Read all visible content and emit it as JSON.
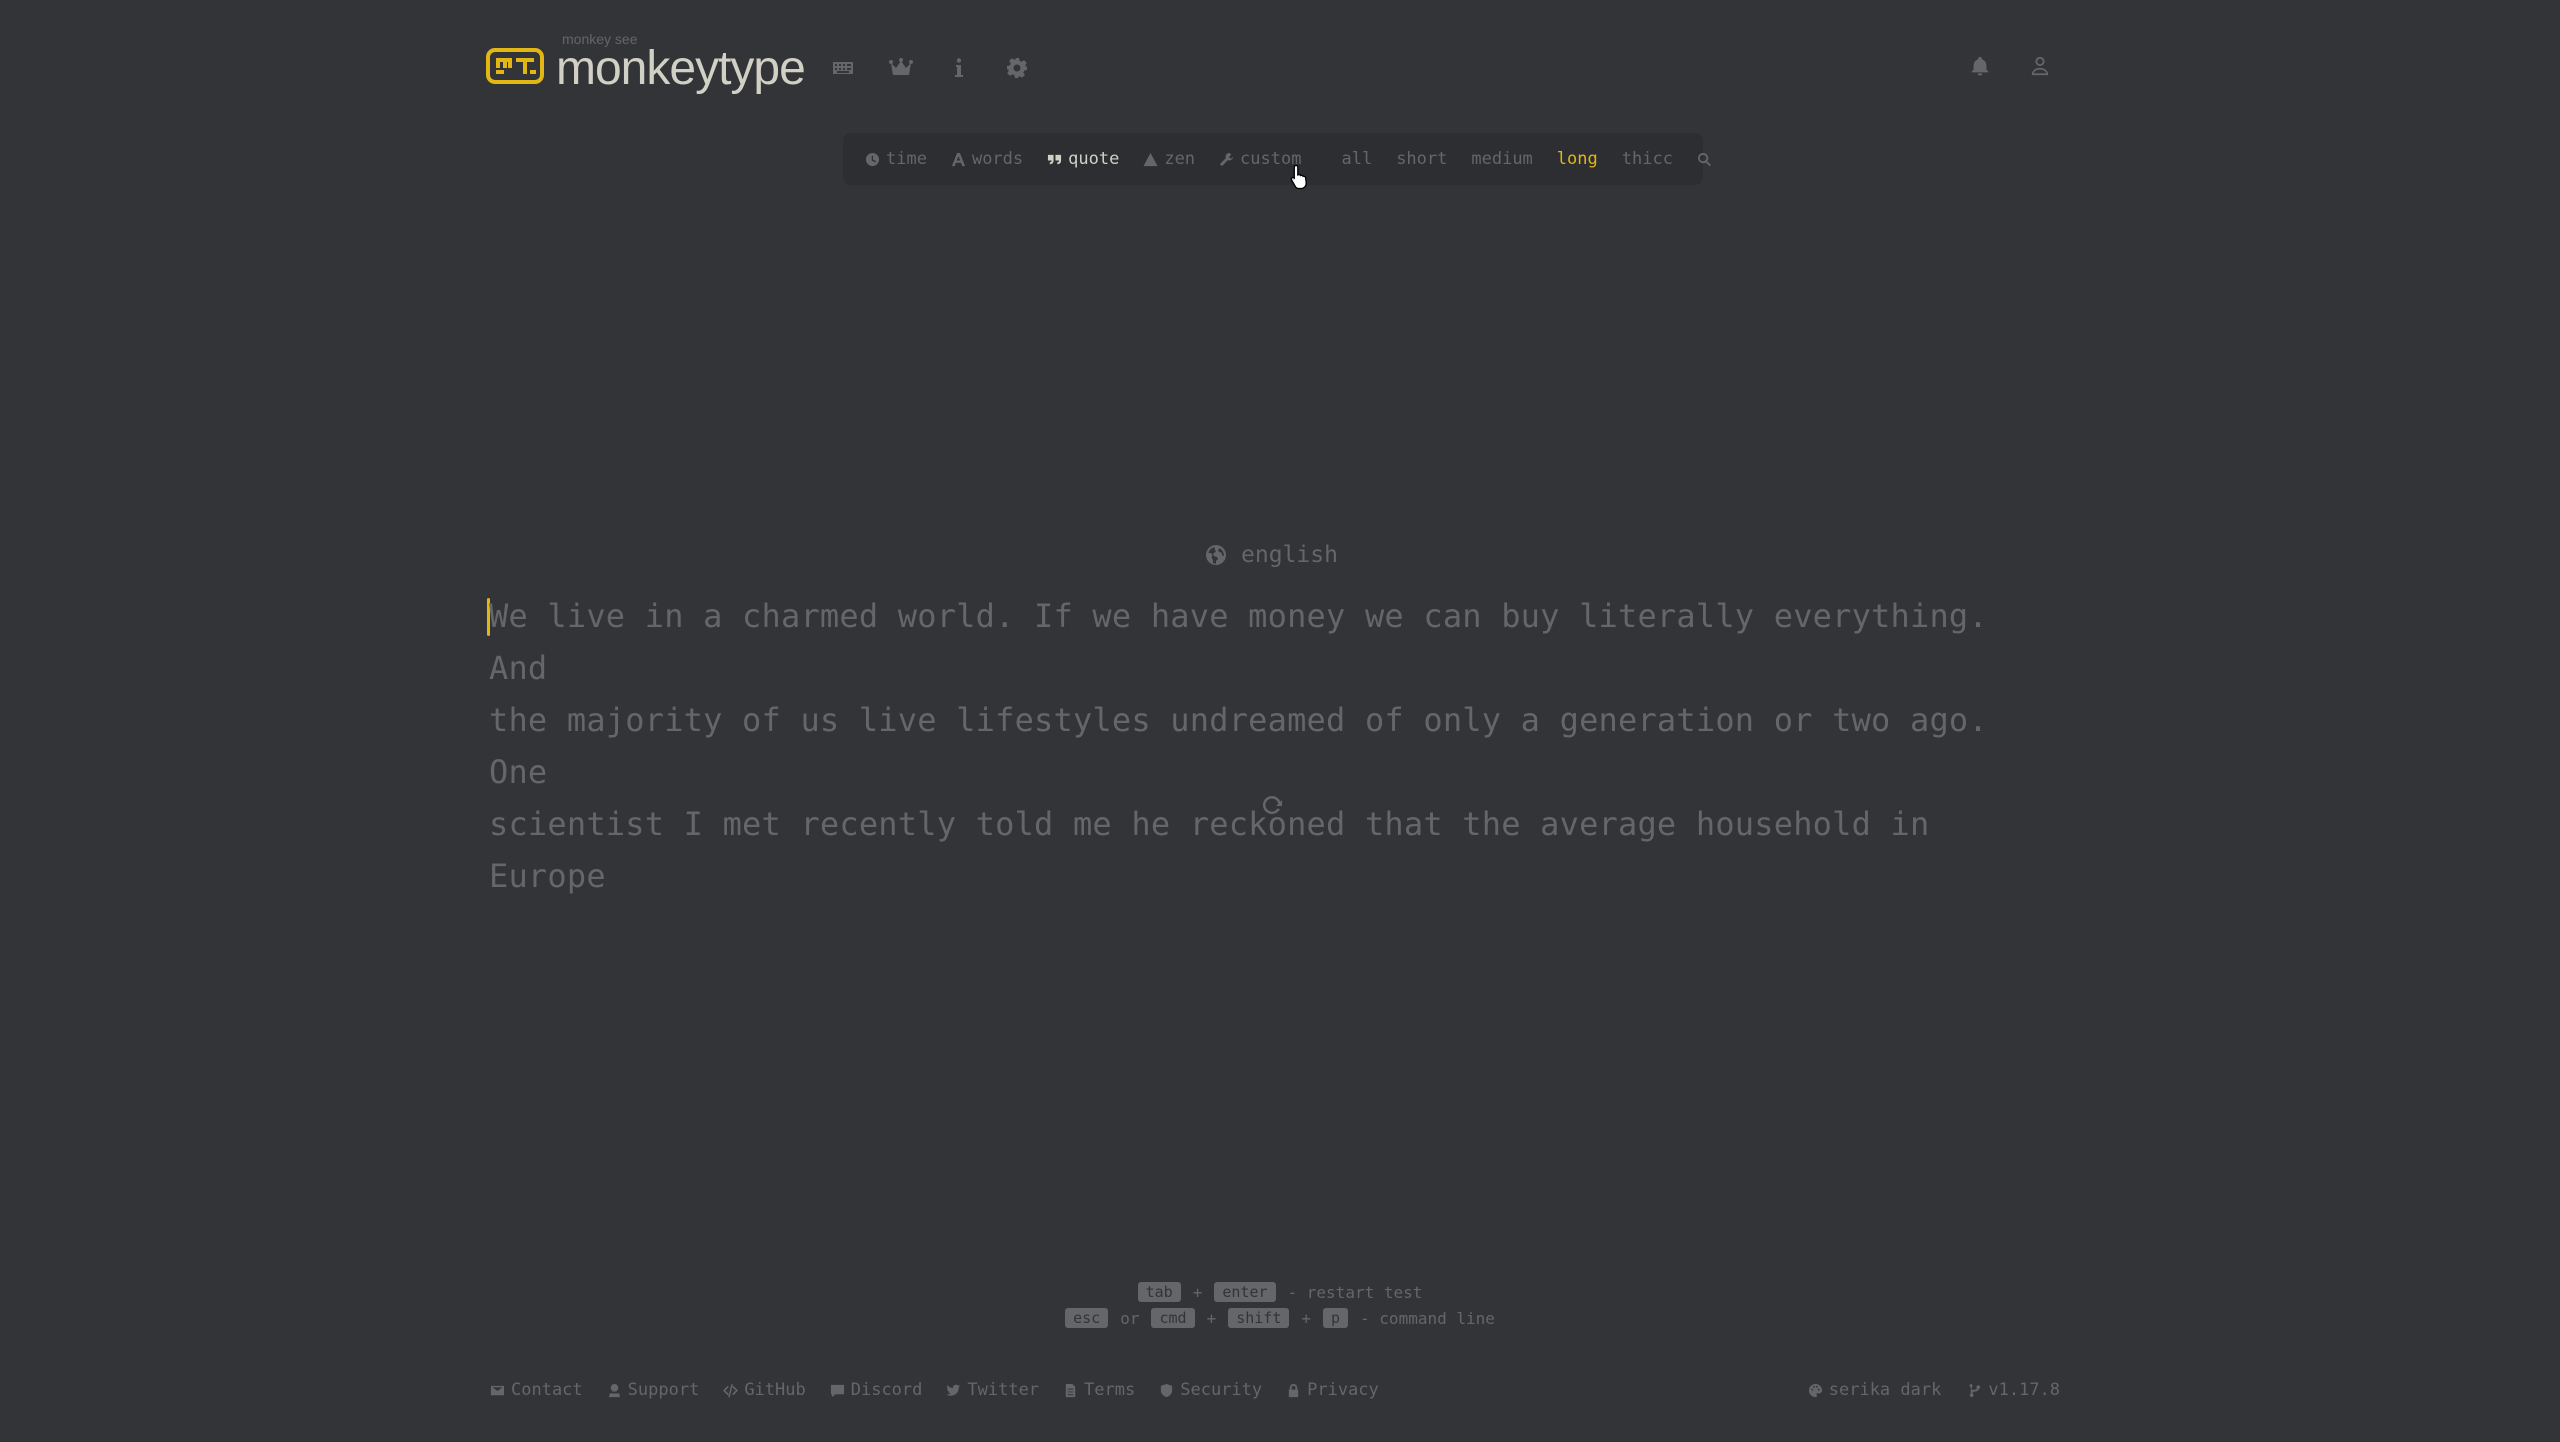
{
  "header": {
    "logo_top": "monkey see",
    "logo_text": "monkeytype",
    "nav_icons": [
      "keyboard-icon",
      "crown-icon",
      "info-icon",
      "gear-icon"
    ],
    "right_icons": [
      "bell-icon",
      "user-icon"
    ]
  },
  "config": {
    "modes": [
      {
        "label": "time",
        "icon": "clock-icon"
      },
      {
        "label": "words",
        "icon": "font-icon"
      },
      {
        "label": "quote",
        "icon": "quote-icon",
        "active": true
      },
      {
        "label": "zen",
        "icon": "mountain-icon"
      },
      {
        "label": "custom",
        "icon": "wrench-icon"
      }
    ],
    "lengths": [
      {
        "label": "all"
      },
      {
        "label": "short"
      },
      {
        "label": "medium"
      },
      {
        "label": "long",
        "active": true
      },
      {
        "label": "thicc"
      }
    ],
    "search_icon": "search-icon"
  },
  "test": {
    "language": "english",
    "text": "We live in a charmed world. If we have money we can buy literally everything. And\nthe majority of us live lifestyles undreamed of only a generation or two ago. One\nscientist I met recently told me he reckoned that the average household in Europe"
  },
  "hints": {
    "row1": {
      "key1": "tab",
      "plus": "+",
      "key2": "enter",
      "label": "- restart test"
    },
    "row2": {
      "key1": "esc",
      "or": "or",
      "key2": "cmd",
      "plus1": "+",
      "key3": "shift",
      "plus2": "+",
      "key4": "p",
      "label": "- command line"
    }
  },
  "footer": {
    "links": [
      "Contact",
      "Support",
      "GitHub",
      "Discord",
      "Twitter",
      "Terms",
      "Security",
      "Privacy"
    ],
    "theme": "serika dark",
    "version": "v1.17.8"
  },
  "colors": {
    "background": "#323437",
    "sub": "#646669",
    "main": "#e2b714",
    "text": "#d1d0c5"
  }
}
